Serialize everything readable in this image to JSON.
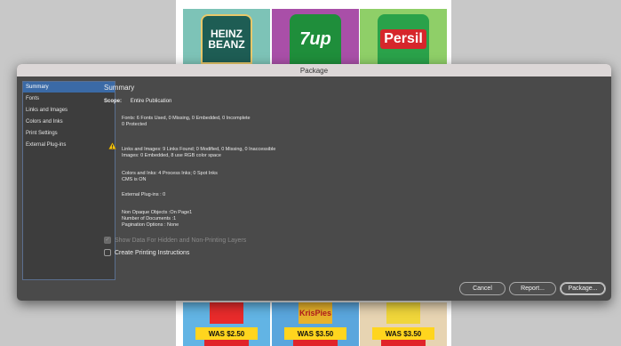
{
  "background": {
    "top_tiles": [
      {
        "label": "HEINZ BEANZ"
      },
      {
        "label": "7up"
      },
      {
        "label": "Persil"
      }
    ],
    "bottom_tiles": [
      {
        "brand": "",
        "price": "WAS $2.50"
      },
      {
        "brand": "KrisPies",
        "price": "WAS $3.50"
      },
      {
        "brand": "",
        "price": "WAS $3.50"
      }
    ]
  },
  "dialog": {
    "title": "Package",
    "sidebar": {
      "items": [
        {
          "label": "Summary",
          "active": true
        },
        {
          "label": "Fonts"
        },
        {
          "label": "Links and Images"
        },
        {
          "label": "Colors and Inks"
        },
        {
          "label": "Print Settings"
        },
        {
          "label": "External Plug-ins"
        }
      ]
    },
    "summary": {
      "heading": "Summary",
      "scope_label": "Scope:",
      "scope_value": "Entire Publication",
      "fonts_line1": "Fonts: 6 Fonts Used, 0 Missing, 0 Embedded, 0 Incomplete",
      "fonts_line2": "0 Protected",
      "links_line1": "Links and Images: 9 Links Found; 0 Modified, 0 Missing, 0 Inaccessible",
      "links_line2": "Images: 0 Embedded, 8 use RGB color space",
      "colors_line1": "Colors and Inks: 4 Process Inks; 0 Spot Inks",
      "colors_line2": "CMS is ON",
      "plugins_line": "External Plug-ins : 0",
      "nonopaque_line": "Non Opaque Objects :On Page1",
      "documents_line": "Number of Documents :1",
      "pagination_line": "Pagination Options : None"
    },
    "options": {
      "show_hidden_label": "Show Data For Hidden and Non-Printing Layers",
      "show_hidden_checked": true,
      "show_hidden_disabled": true,
      "printing_instructions_label": "Create Printing Instructions",
      "printing_instructions_checked": false
    },
    "buttons": {
      "cancel": "Cancel",
      "report": "Report...",
      "package": "Package..."
    },
    "colors": {
      "accent": "#3b6aa6",
      "warning": "#f4c20d"
    }
  }
}
